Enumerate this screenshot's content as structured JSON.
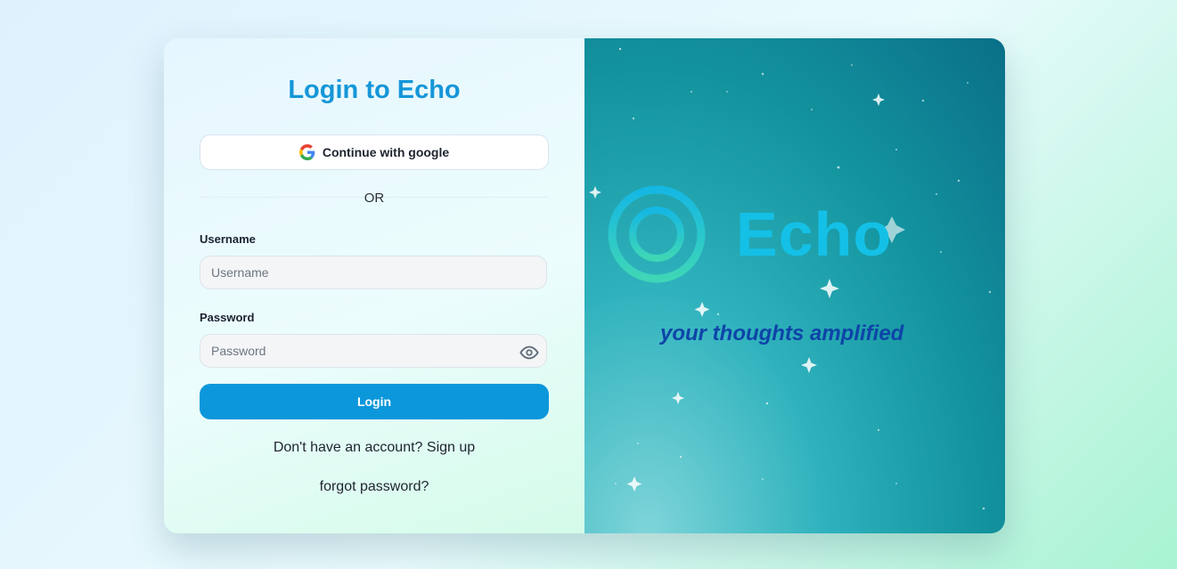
{
  "login": {
    "title": "Login to Echo",
    "google_button": "Continue with google",
    "or_text": "OR",
    "username_label": "Username",
    "username_placeholder": "Username",
    "password_label": "Password",
    "password_placeholder": "Password",
    "login_button": "Login",
    "signup_text": "Don't have an account? Sign up",
    "forgot_text": "forgot password?"
  },
  "brand_panel": {
    "brand_name": "Echo",
    "tagline": "your thoughts amplified"
  },
  "icons": {
    "google": "google-icon",
    "eye": "eye-icon",
    "logo": "echo-logo-icon"
  },
  "colors": {
    "accent": "#0d97db",
    "title": "#1596d8",
    "brand": "#14c0e6",
    "tagline": "#0e44a8"
  }
}
